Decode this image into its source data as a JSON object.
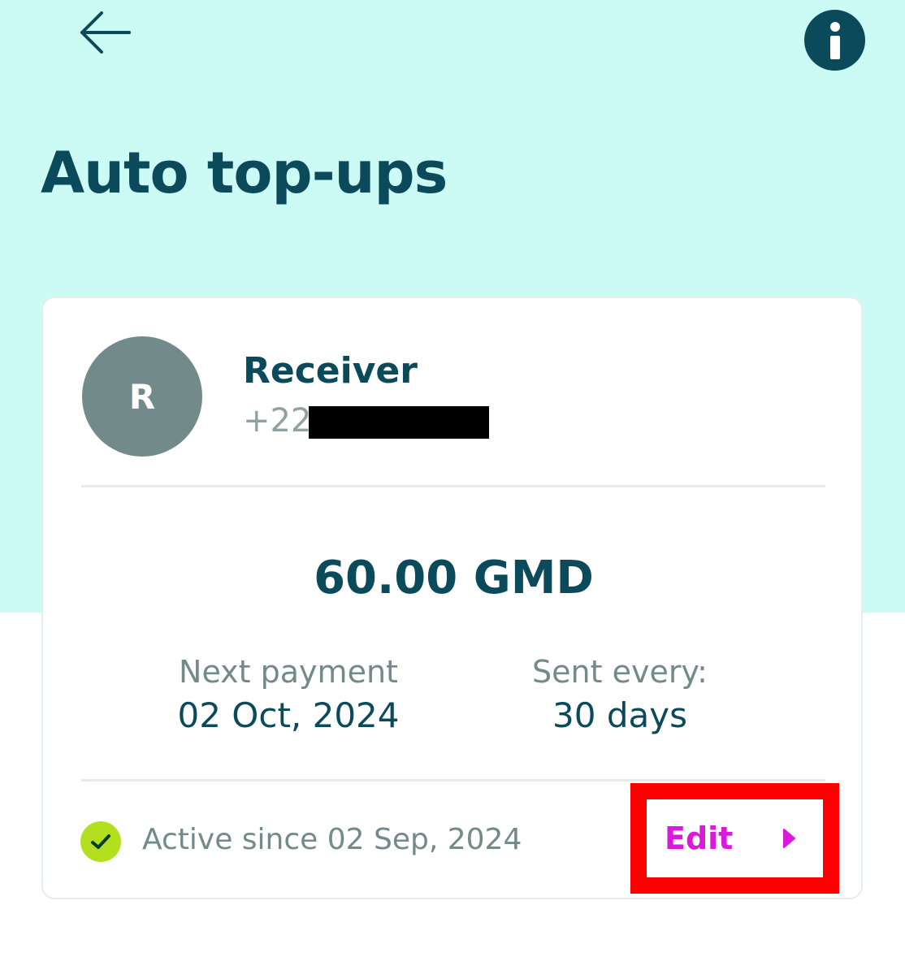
{
  "header": {
    "title": "Auto top-ups",
    "back_icon": "arrow-left-icon",
    "info_icon": "info-icon"
  },
  "card": {
    "avatar_initial": "R",
    "receiver_name": "Receiver",
    "receiver_phone": "+220",
    "amount": "60.00 GMD",
    "next_payment_label": "Next payment",
    "next_payment_value": "02 Oct, 2024",
    "frequency_label": "Sent every:",
    "frequency_value": "30 days",
    "status_icon": "check-circle-icon",
    "status_text": "Active since 02 Sep, 2024",
    "edit_label": "Edit",
    "edit_icon": "caret-right-icon"
  },
  "colors": {
    "header_bg": "#ccfbf6",
    "primary_text": "#0a4a5a",
    "muted_text": "#738a8a",
    "avatar_bg": "#738a8a",
    "accent": "#d81bd8",
    "status_green": "#b3e01e",
    "highlight": "#ff0000"
  }
}
